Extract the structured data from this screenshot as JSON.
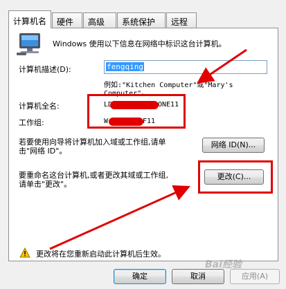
{
  "tabs": [
    {
      "label": "计算机名",
      "active": true
    },
    {
      "label": "硬件"
    },
    {
      "label": "高级"
    },
    {
      "label": "系统保护"
    },
    {
      "label": "远程"
    }
  ],
  "intro_text": "Windows 使用以下信息在网络中标识这台计算机。",
  "description": {
    "label": "计算机描述(D):",
    "value": "fengqing",
    "example_line1": "例如:\"Kitchen Computer\"或\"Mary's",
    "example_line2": "Computer\"。"
  },
  "full_name": {
    "label": "计算机全名:",
    "value_visible_prefix": "LDB",
    "value_visible_suffix": "ONE11"
  },
  "workgroup": {
    "label": "工作组:",
    "value_visible_prefix": "W",
    "value_visible_suffix": "F11"
  },
  "network_id": {
    "text_line1": "若要使用向导将计算机加入域或工作组,请单",
    "text_line2": "击\"网络 ID\"。",
    "button": "网络 ID(N)..."
  },
  "change": {
    "text_line1": "要重命名这台计算机,或者更改其域或工作组,",
    "text_line2": "请单击\"更改\"。",
    "button": "更改(C)..."
  },
  "warning_text": "更改将在您重新启动此计算机后生效。",
  "footer": {
    "ok": "确定",
    "cancel": "取消",
    "apply": "应用(A)"
  },
  "watermark": "Bai经验",
  "colors": {
    "annotation_red": "#e00000",
    "selection_blue": "#3399ff"
  }
}
